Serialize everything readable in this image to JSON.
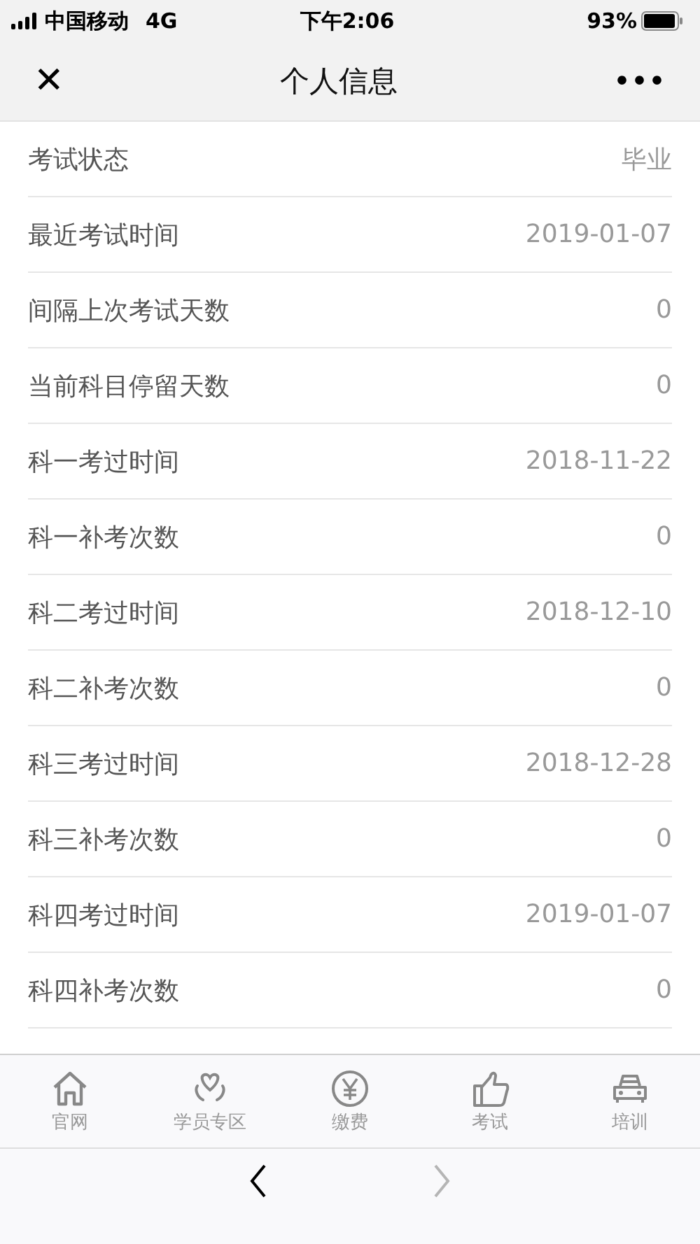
{
  "status_bar": {
    "carrier": "中国移动",
    "network": "4G",
    "time": "下午2:06",
    "battery": "93%"
  },
  "nav_bar": {
    "close": "✕",
    "title": "个人信息",
    "more": "•••"
  },
  "info_rows": [
    {
      "label": "考试状态",
      "value": "毕业"
    },
    {
      "label": "最近考试时间",
      "value": "2019-01-07"
    },
    {
      "label": "间隔上次考试天数",
      "value": "0"
    },
    {
      "label": "当前科目停留天数",
      "value": "0"
    },
    {
      "label": "科一考过时间",
      "value": "2018-11-22"
    },
    {
      "label": "科一补考次数",
      "value": "0"
    },
    {
      "label": "科二考过时间",
      "value": "2018-12-10"
    },
    {
      "label": "科二补考次数",
      "value": "0"
    },
    {
      "label": "科三考过时间",
      "value": "2018-12-28"
    },
    {
      "label": "科三补考次数",
      "value": "0"
    },
    {
      "label": "科四考过时间",
      "value": "2019-01-07"
    },
    {
      "label": "科四补考次数",
      "value": "0"
    }
  ],
  "tab_bar": [
    {
      "kind": "home",
      "label": "官网",
      "selected": false
    },
    {
      "kind": "heart",
      "label": "学员专区",
      "selected": false
    },
    {
      "kind": "yen",
      "label": "缴费",
      "selected": false
    },
    {
      "kind": "thumb",
      "label": "考试",
      "selected": false
    },
    {
      "kind": "car",
      "label": "培训",
      "selected": false
    }
  ],
  "browser_bar": {
    "back": {
      "disabled": false
    },
    "forward": {
      "disabled": true
    }
  }
}
